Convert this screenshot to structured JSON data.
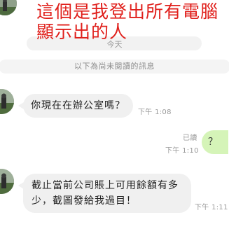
{
  "annotation": {
    "line1": "這個是我登出所有電腦",
    "line2": "顯示出的人",
    "color": "#e0201c"
  },
  "date_separator": "今天",
  "unread_divider": "以下為尚未閱讀的訊息",
  "messages": [
    {
      "direction": "incoming",
      "text": "你現在在辦公室嗎？",
      "time": "下午 1:08"
    },
    {
      "direction": "outgoing",
      "text": "？",
      "read_status": "已讀",
      "time": "下午 1:10"
    },
    {
      "direction": "incoming",
      "text": "截止當前公司賬上可用餘額有多少，截圖發給我過目！",
      "time": "下午 1:11"
    }
  ],
  "colors": {
    "incoming_bubble": "#f0f0f0",
    "outgoing_bubble": "#d5f4b8",
    "meta_text": "#9a9a9a"
  }
}
